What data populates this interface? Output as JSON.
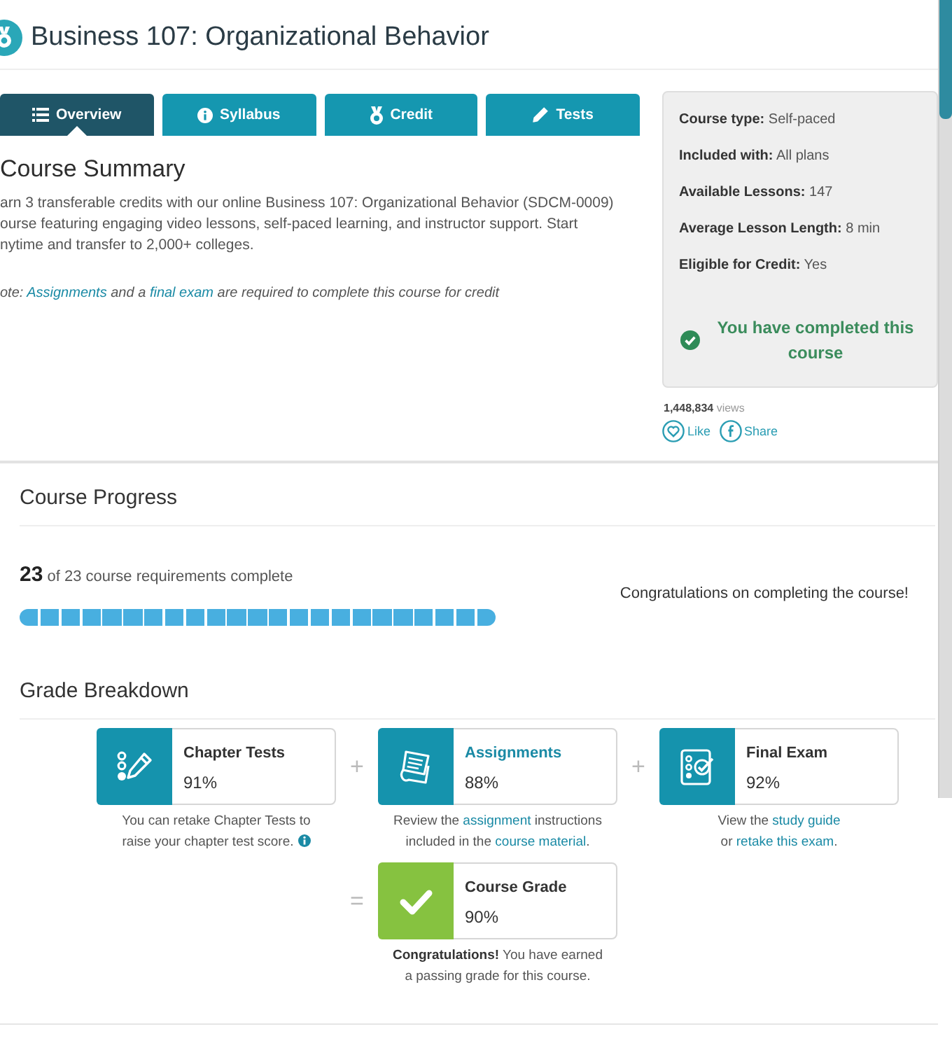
{
  "header": {
    "title": "Business 107: Organizational Behavior"
  },
  "tabs": [
    {
      "kind": "list",
      "label": "Overview",
      "selected": true
    },
    {
      "kind": "info",
      "label": "Syllabus",
      "selected": false
    },
    {
      "kind": "medal",
      "label": "Credit",
      "selected": false
    },
    {
      "kind": "pencil",
      "label": "Tests",
      "selected": false
    }
  ],
  "summary": {
    "title": "Course Summary",
    "lines": [
      "arn 3 transferable credits with our online Business 107: Organizational Behavior (SDCM-0009)",
      "ourse featuring engaging video lessons, self-paced learning, and instructor support. Start",
      "nytime and transfer to 2,000+ colleges."
    ],
    "note": [
      {
        "kind": "text",
        "text": "ote: "
      },
      {
        "kind": "link",
        "text": "Assignments"
      },
      {
        "kind": "text",
        "text": " and a "
      },
      {
        "kind": "link",
        "text": "final exam"
      },
      {
        "kind": "text",
        "text": " are required to complete this course for credit"
      }
    ]
  },
  "details": {
    "facts": [
      {
        "label": "Course type:",
        "value": "Self-paced"
      },
      {
        "label": "Included with:",
        "value": "All plans"
      },
      {
        "label": "Available Lessons:",
        "value": "147"
      },
      {
        "label": "Average Lesson Length:",
        "value": "8 min"
      },
      {
        "label": "Eligible for Credit:",
        "value": "Yes"
      }
    ],
    "completed": true,
    "completed_message": "You have completed this course"
  },
  "stats": {
    "views_count": "1,448,834",
    "views_label": "views",
    "actions": [
      {
        "kind": "like",
        "label": "Like"
      },
      {
        "kind": "share",
        "label": "Share"
      }
    ]
  },
  "progress": {
    "title": "Course Progress",
    "count": "23",
    "summary": "of 23 course requirements complete",
    "segments": [
      {
        "filled": true
      },
      {
        "filled": true
      },
      {
        "filled": true
      },
      {
        "filled": true
      },
      {
        "filled": true
      },
      {
        "filled": true
      },
      {
        "filled": true
      },
      {
        "filled": true
      },
      {
        "filled": true
      },
      {
        "filled": true
      },
      {
        "filled": true
      },
      {
        "filled": true
      },
      {
        "filled": true
      },
      {
        "filled": true
      },
      {
        "filled": true
      },
      {
        "filled": true
      },
      {
        "filled": true
      },
      {
        "filled": true
      },
      {
        "filled": true
      },
      {
        "filled": true
      },
      {
        "filled": true
      },
      {
        "filled": true
      },
      {
        "filled": true
      }
    ],
    "message": "Congratulations on completing the course!"
  },
  "grade_breakdown": {
    "title": "Grade Breakdown",
    "components": [
      {
        "kind": "tests",
        "title": "Chapter Tests",
        "title_link": false,
        "score": "91%",
        "caption_lines": [
          [
            {
              "kind": "text",
              "text": "You can retake Chapter Tests to"
            }
          ],
          [
            {
              "kind": "text",
              "text": "raise your chapter test score."
            }
          ]
        ],
        "info_icon": true
      },
      {
        "kind": "assignments",
        "operator": "+",
        "title": "Assignments",
        "title_link": true,
        "score": "88%",
        "caption_lines": [
          [
            {
              "kind": "text",
              "text": "Review the "
            },
            {
              "kind": "link",
              "text": "assignment"
            },
            {
              "kind": "text",
              "text": " instructions"
            }
          ],
          [
            {
              "kind": "text",
              "text": "included in the "
            },
            {
              "kind": "link",
              "text": "course material"
            },
            {
              "kind": "text",
              "text": "."
            }
          ]
        ],
        "info_icon": false
      },
      {
        "kind": "exam",
        "operator": "+",
        "title": "Final Exam",
        "title_link": false,
        "score": "92%",
        "caption_lines": [
          [
            {
              "kind": "text",
              "text": "View the "
            },
            {
              "kind": "link",
              "text": "study guide"
            }
          ],
          [
            {
              "kind": "text",
              "text": "or "
            },
            {
              "kind": "link",
              "text": "retake this exam"
            },
            {
              "kind": "text",
              "text": "."
            }
          ]
        ],
        "info_icon": false
      }
    ],
    "total": {
      "operator": "=",
      "title": "Course Grade",
      "score": "90%",
      "passed": true,
      "caption_lines": [
        [
          {
            "kind": "text",
            "text": "**Congratulations!** You have earned"
          }
        ],
        [
          {
            "kind": "text",
            "text": "a passing grade for this course."
          }
        ]
      ]
    }
  }
}
